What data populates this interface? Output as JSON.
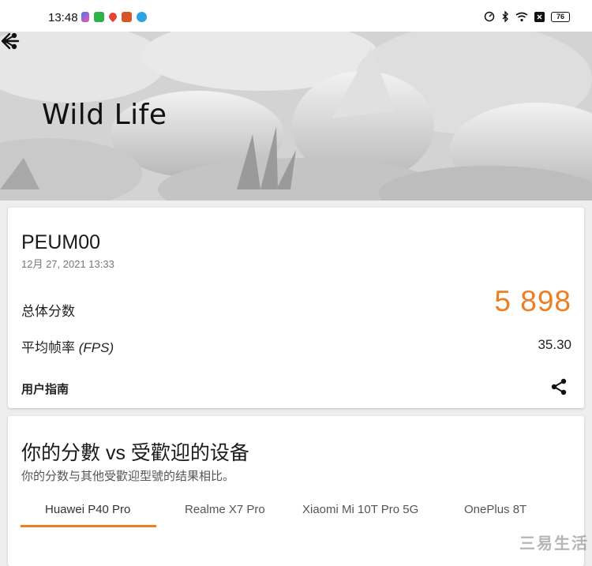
{
  "status_bar": {
    "time": "13:48",
    "battery": "76",
    "icons": [
      "app-icon-1",
      "app-icon-2",
      "location-pin-icon",
      "app-icon-3",
      "telegram-icon",
      "speed-icon",
      "bluetooth-icon",
      "wifi-icon",
      "close-box-icon",
      "battery-icon"
    ]
  },
  "hero": {
    "title": "Wild Life"
  },
  "result": {
    "device": "PEUM00",
    "date": "12月 27, 2021 13:33",
    "score_label": "总体分数",
    "score_value": "5 898",
    "fps_label_main": "平均帧率",
    "fps_label_unit": "(FPS)",
    "fps_value": "35.30",
    "guide_label": "用户指南"
  },
  "compare": {
    "title": "你的分數 vs 受歡迎的设备",
    "subtitle": "你的分数与其他受歡迎型號的结果相比。",
    "tabs": [
      {
        "label": "Huawei P40 Pro",
        "active": true
      },
      {
        "label": "Realme X7 Pro",
        "active": false
      },
      {
        "label": "Xiaomi Mi 10T Pro 5G",
        "active": false
      },
      {
        "label": "OnePlus 8T",
        "active": false
      }
    ]
  },
  "watermark": "三易生活",
  "colors": {
    "accent": "#ef7d22",
    "background": "#eeeeee",
    "card": "#ffffff"
  }
}
